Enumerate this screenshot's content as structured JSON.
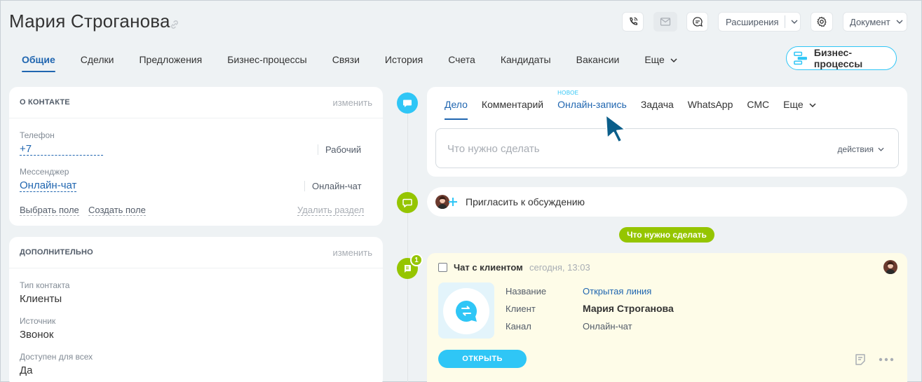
{
  "header": {
    "title": "Мария Строганова",
    "extensions_label": "Расширения",
    "document_label": "Документ"
  },
  "tabs": [
    {
      "label": "Общие",
      "active": true
    },
    {
      "label": "Сделки"
    },
    {
      "label": "Предложения"
    },
    {
      "label": "Бизнес-процессы"
    },
    {
      "label": "Связи"
    },
    {
      "label": "История"
    },
    {
      "label": "Счета"
    },
    {
      "label": "Кандидаты"
    },
    {
      "label": "Вакансии"
    },
    {
      "label": "Еще"
    }
  ],
  "bp_button_label": "Бизнес-процессы",
  "about": {
    "title": "О КОНТАКТЕ",
    "edit": "изменить",
    "phone_label": "Телефон",
    "phone_value": "+7",
    "phone_type": "Рабочий",
    "messenger_label": "Мессенджер",
    "messenger_value": "Онлайн-чат",
    "messenger_type": "Онлайн-чат",
    "select_field": "Выбрать поле",
    "create_field": "Создать поле",
    "delete_section": "Удалить раздел"
  },
  "extra": {
    "title": "ДОПОЛНИТЕЛЬНО",
    "edit": "изменить",
    "type_label": "Тип контакта",
    "type_value": "Клиенты",
    "source_label": "Источник",
    "source_value": "Звонок",
    "public_label": "Доступен для всех",
    "public_value": "Да"
  },
  "editor": {
    "tabs": [
      "Дело",
      "Комментарий",
      "Онлайн-запись",
      "Задача",
      "WhatsApp",
      "СМС",
      "Еще"
    ],
    "new_badge": "НОВОЕ",
    "placeholder": "Что нужно сделать",
    "actions": "действия"
  },
  "invite_text": "Пригласить к обсуждению",
  "todo_pill": "Что нужно сделать",
  "chat": {
    "count": "1",
    "title": "Чат с клиентом",
    "time": "сегодня, 13:03",
    "name_label": "Название",
    "name_value": "Открытая линия",
    "client_label": "Клиент",
    "client_value": "Мария Строганова",
    "channel_label": "Канал",
    "channel_value": "Онлайн-чат",
    "open_button": "ОТКРЫТЬ"
  },
  "colors": {
    "accent_blue": "#2066b0",
    "cyan": "#2fc6f6",
    "green": "#95c500"
  }
}
